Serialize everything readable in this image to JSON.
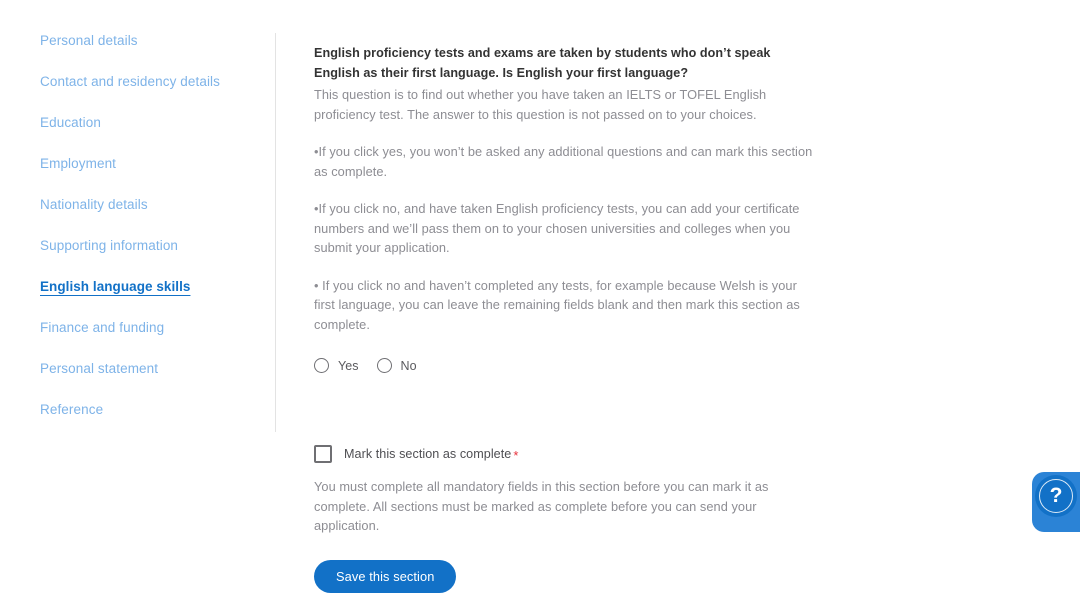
{
  "sidebar": {
    "items": [
      {
        "label": "Personal details",
        "active": false
      },
      {
        "label": "Contact and residency details",
        "active": false
      },
      {
        "label": "Education",
        "active": false
      },
      {
        "label": "Employment",
        "active": false
      },
      {
        "label": "Nationality details",
        "active": false
      },
      {
        "label": "Supporting information",
        "active": false
      },
      {
        "label": "English language skills",
        "active": true
      },
      {
        "label": "Finance and funding",
        "active": false
      },
      {
        "label": "Personal statement",
        "active": false
      },
      {
        "label": "Reference",
        "active": false
      }
    ]
  },
  "main": {
    "question_heading": "English proficiency tests and exams are taken by students who don’t speak English as their first language. Is English your first language?",
    "intro_text": "This question is to find out whether you have taken an IELTS or TOFEL English proficiency test. The answer to this question is not passed on to your choices.",
    "bullets": [
      "•If you click yes, you won’t be asked any additional questions and can mark this section as complete.",
      "•If you click no, and have taken English proficiency tests, you can add your certificate numbers and we’ll pass them on to your chosen universities and colleges when you submit your application.",
      "• If you click no and haven’t completed any tests, for example because Welsh is your first language, you can leave the remaining fields blank and then mark this section as complete."
    ],
    "radios": {
      "options": [
        {
          "label": "Yes",
          "selected": false
        },
        {
          "label": "No",
          "selected": false
        }
      ]
    },
    "complete_checkbox": {
      "label": "Mark this section as complete",
      "required_marker": "*",
      "checked": false
    },
    "helper_text": "You must complete all mandatory fields in this section before you can mark it as complete. All sections must be marked as complete before you can send your application.",
    "save_button_label": "Save this section"
  },
  "help_widget": {
    "glyph": "?"
  },
  "colors": {
    "accent_blue": "#1271c7",
    "sidebar_link": "#7eb3e8",
    "body_text": "#8d8d93",
    "heading_text": "#333333",
    "required_red": "#e8323c",
    "divider": "#e3e3e3"
  }
}
